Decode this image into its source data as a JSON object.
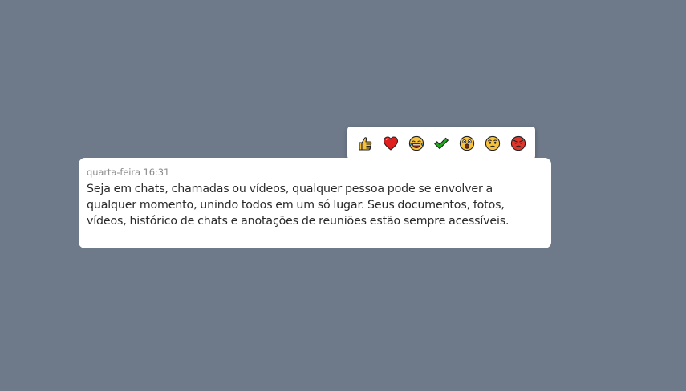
{
  "message": {
    "timestamp": "quarta-feira 16:31",
    "text": "Seja em chats, chamadas ou vídeos, qualquer pessoa pode se envolver a qualquer momento, unindo todos em um só lugar. Seus documentos, fotos, vídeos, histórico de chats e anotações de reuniões estão sempre acessíveis."
  },
  "reactions": [
    {
      "icon": "thumbs-up-icon"
    },
    {
      "icon": "heart-icon"
    },
    {
      "icon": "laughing-face-icon"
    },
    {
      "icon": "checkmark-icon"
    },
    {
      "icon": "surprised-face-icon"
    },
    {
      "icon": "sad-face-icon"
    },
    {
      "icon": "angry-face-icon"
    }
  ],
  "colors": {
    "background": "#6e7a8a",
    "card": "#ffffff",
    "text": "#2a2a2a",
    "timestamp": "#8a8a8a",
    "emoji_yellow": "#f7c23b",
    "heart_red": "#e0201f",
    "check_green": "#25a51f",
    "angry_red": "#e0352a"
  }
}
